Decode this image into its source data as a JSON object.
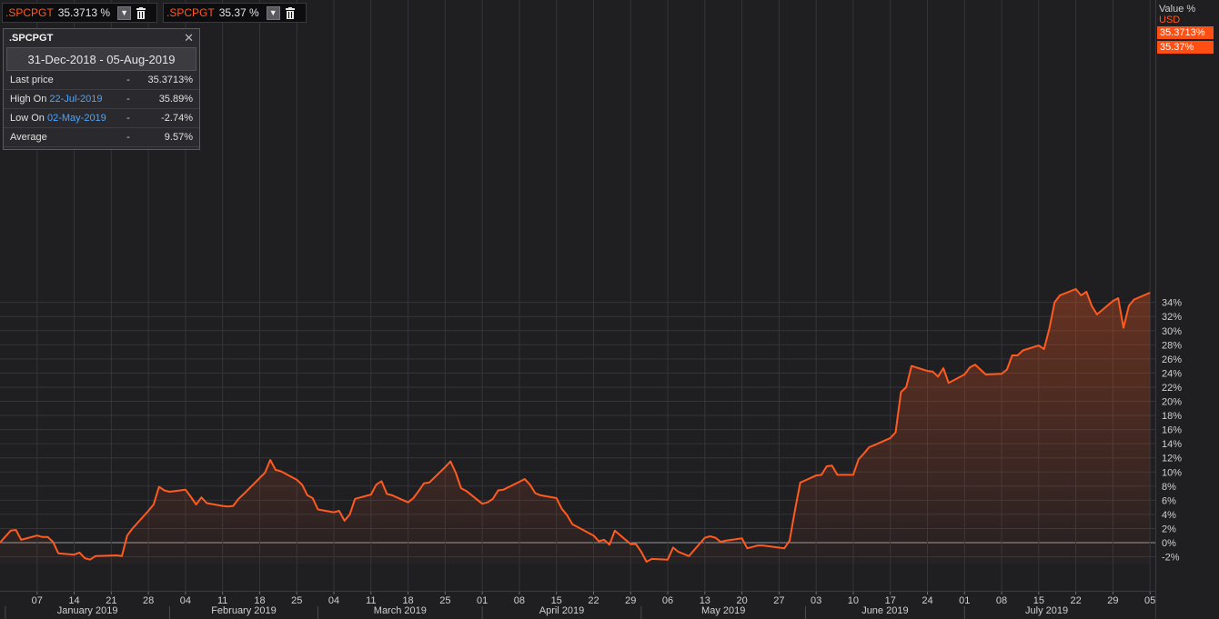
{
  "legend": [
    {
      "name": ".SPCPGT",
      "value": "35.3713 %"
    },
    {
      "name": ".SPCPGT",
      "value": "35.37 %"
    }
  ],
  "panel": {
    "title": ".SPCPGT",
    "range": "31-Dec-2018 - 05-Aug-2019",
    "rows": [
      {
        "label": "Last price",
        "date": "",
        "dash": "-",
        "value": "35.3713%"
      },
      {
        "label": "High On",
        "date": "22-Jul-2019",
        "dash": "-",
        "value": "35.89%"
      },
      {
        "label": "Low On",
        "date": "02-May-2019",
        "dash": "-",
        "value": "-2.74%"
      },
      {
        "label": "Average",
        "date": "",
        "dash": "-",
        "value": "9.57%"
      }
    ]
  },
  "axis": {
    "unit_label": "Value %",
    "currency": "USD",
    "value_tags": [
      "35.3713%",
      "35.37%"
    ]
  },
  "colors": {
    "line": "#ff5a1f",
    "background": "#1f1f22",
    "grid": "#34343a",
    "zero_line": "#9a9a9a"
  },
  "chart_data": {
    "type": "area",
    "ylim": [
      -3,
      38
    ],
    "yticks": [
      -2,
      0,
      2,
      4,
      6,
      8,
      10,
      12,
      14,
      16,
      18,
      20,
      22,
      24,
      26,
      28,
      30,
      32,
      34
    ],
    "ytick_labels": [
      "-2%",
      "0%",
      "2%",
      "4%",
      "6%",
      "8%",
      "10%",
      "12%",
      "14%",
      "16%",
      "18%",
      "20%",
      "22%",
      "24%",
      "26%",
      "28%",
      "30%",
      "32%",
      "34%"
    ],
    "x_start": "2018-12-31",
    "x_end": "2019-08-06",
    "xtick_dates": [
      "2019-01-07",
      "2019-01-14",
      "2019-01-21",
      "2019-01-28",
      "2019-02-04",
      "2019-02-11",
      "2019-02-18",
      "2019-02-25",
      "2019-03-04",
      "2019-03-11",
      "2019-03-18",
      "2019-03-25",
      "2019-04-01",
      "2019-04-08",
      "2019-04-15",
      "2019-04-22",
      "2019-04-29",
      "2019-05-06",
      "2019-05-13",
      "2019-05-20",
      "2019-05-27",
      "2019-06-03",
      "2019-06-10",
      "2019-06-17",
      "2019-06-24",
      "2019-07-01",
      "2019-07-08",
      "2019-07-15",
      "2019-07-22",
      "2019-07-29",
      "2019-08-05"
    ],
    "xtick_labels": [
      "07",
      "14",
      "21",
      "28",
      "04",
      "11",
      "18",
      "25",
      "04",
      "11",
      "18",
      "25",
      "01",
      "08",
      "15",
      "22",
      "29",
      "06",
      "13",
      "20",
      "27",
      "03",
      "10",
      "17",
      "24",
      "01",
      "08",
      "15",
      "22",
      "29",
      "05"
    ],
    "months": [
      {
        "label": "January 2019",
        "start": "2019-01-01",
        "end": "2019-01-31"
      },
      {
        "label": "February 2019",
        "start": "2019-02-01",
        "end": "2019-02-28"
      },
      {
        "label": "March 2019",
        "start": "2019-03-01",
        "end": "2019-03-31"
      },
      {
        "label": "April 2019",
        "start": "2019-04-01",
        "end": "2019-04-30"
      },
      {
        "label": "May 2019",
        "start": "2019-05-01",
        "end": "2019-05-31"
      },
      {
        "label": "June 2019",
        "start": "2019-06-01",
        "end": "2019-06-30"
      },
      {
        "label": "July 2019",
        "start": "2019-07-01",
        "end": "2019-07-31"
      }
    ],
    "series": [
      {
        "x": [
          "2018-12-31",
          "2019-01-02",
          "2019-01-03",
          "2019-01-04",
          "2019-01-07",
          "2019-01-08",
          "2019-01-09",
          "2019-01-10",
          "2019-01-11",
          "2019-01-14",
          "2019-01-15",
          "2019-01-16",
          "2019-01-17",
          "2019-01-18",
          "2019-01-22",
          "2019-01-23",
          "2019-01-24",
          "2019-01-25",
          "2019-01-28",
          "2019-01-29",
          "2019-01-30",
          "2019-01-31",
          "2019-02-01",
          "2019-02-04",
          "2019-02-05",
          "2019-02-06",
          "2019-02-07",
          "2019-02-08",
          "2019-02-11",
          "2019-02-12",
          "2019-02-13",
          "2019-02-14",
          "2019-02-15",
          "2019-02-19",
          "2019-02-20",
          "2019-02-21",
          "2019-02-22",
          "2019-02-25",
          "2019-02-26",
          "2019-02-27",
          "2019-02-28",
          "2019-03-01",
          "2019-03-04",
          "2019-03-05",
          "2019-03-06",
          "2019-03-07",
          "2019-03-08",
          "2019-03-11",
          "2019-03-12",
          "2019-03-13",
          "2019-03-14",
          "2019-03-15",
          "2019-03-18",
          "2019-03-19",
          "2019-03-20",
          "2019-03-21",
          "2019-03-22",
          "2019-03-25",
          "2019-03-26",
          "2019-03-27",
          "2019-03-28",
          "2019-03-29",
          "2019-04-01",
          "2019-04-02",
          "2019-04-03",
          "2019-04-04",
          "2019-04-05",
          "2019-04-08",
          "2019-04-09",
          "2019-04-10",
          "2019-04-11",
          "2019-04-12",
          "2019-04-15",
          "2019-04-16",
          "2019-04-17",
          "2019-04-18",
          "2019-04-22",
          "2019-04-23",
          "2019-04-24",
          "2019-04-25",
          "2019-04-26",
          "2019-04-29",
          "2019-04-30",
          "2019-05-01",
          "2019-05-02",
          "2019-05-03",
          "2019-05-06",
          "2019-05-07",
          "2019-05-08",
          "2019-05-09",
          "2019-05-10",
          "2019-05-13",
          "2019-05-14",
          "2019-05-15",
          "2019-05-16",
          "2019-05-17",
          "2019-05-20",
          "2019-05-21",
          "2019-05-22",
          "2019-05-23",
          "2019-05-24",
          "2019-05-28",
          "2019-05-29",
          "2019-05-30",
          "2019-05-31",
          "2019-06-03",
          "2019-06-04",
          "2019-06-05",
          "2019-06-06",
          "2019-06-07",
          "2019-06-10",
          "2019-06-11",
          "2019-06-12",
          "2019-06-13",
          "2019-06-14",
          "2019-06-17",
          "2019-06-18",
          "2019-06-19",
          "2019-06-20",
          "2019-06-21",
          "2019-06-24",
          "2019-06-25",
          "2019-06-26",
          "2019-06-27",
          "2019-06-28",
          "2019-07-01",
          "2019-07-02",
          "2019-07-03",
          "2019-07-05",
          "2019-07-08",
          "2019-07-09",
          "2019-07-10",
          "2019-07-11",
          "2019-07-12",
          "2019-07-15",
          "2019-07-16",
          "2019-07-17",
          "2019-07-18",
          "2019-07-19",
          "2019-07-22",
          "2019-07-23",
          "2019-07-24",
          "2019-07-25",
          "2019-07-26",
          "2019-07-29",
          "2019-07-30",
          "2019-07-31",
          "2019-08-01",
          "2019-08-02",
          "2019-08-05"
        ],
        "y": [
          0.0,
          1.7,
          1.8,
          0.4,
          1.0,
          0.8,
          0.8,
          0.1,
          -1.5,
          -1.7,
          -1.4,
          -2.2,
          -2.4,
          -1.9,
          -1.8,
          -1.9,
          1.0,
          2.0,
          4.5,
          5.4,
          7.9,
          7.4,
          7.2,
          7.5,
          6.5,
          5.4,
          6.4,
          5.6,
          5.2,
          5.1,
          5.2,
          6.2,
          6.9,
          9.9,
          11.7,
          10.3,
          10.1,
          8.9,
          8.2,
          6.7,
          6.3,
          4.7,
          4.3,
          4.5,
          3.1,
          4.0,
          6.2,
          6.8,
          8.2,
          8.7,
          6.9,
          6.7,
          5.7,
          6.3,
          7.3,
          8.4,
          8.5,
          10.7,
          11.5,
          9.9,
          7.7,
          7.3,
          5.5,
          5.7,
          6.2,
          7.4,
          7.5,
          8.6,
          9.0,
          8.2,
          7.0,
          6.7,
          6.3,
          4.8,
          3.9,
          2.6,
          1.0,
          0.2,
          0.4,
          -0.3,
          1.7,
          -0.2,
          -0.2,
          -1.3,
          -2.7,
          -2.3,
          -2.4,
          -0.7,
          -1.3,
          -1.6,
          -1.9,
          0.7,
          0.9,
          0.7,
          0.1,
          0.3,
          0.6,
          -0.8,
          -0.6,
          -0.4,
          -0.4,
          -0.8,
          0.3,
          4.6,
          8.5,
          9.5,
          9.6,
          10.8,
          10.9,
          9.6,
          9.6,
          11.8,
          12.6,
          13.5,
          13.8,
          14.8,
          15.6,
          21.3,
          22.0,
          25.0,
          24.3,
          24.2,
          23.5,
          24.7,
          22.6,
          23.8,
          24.8,
          25.2,
          23.8,
          23.9,
          24.5,
          26.5,
          26.5,
          27.2,
          27.9,
          27.4,
          30.3,
          34.0,
          35.0,
          35.89,
          35.0,
          35.5,
          33.5,
          32.3,
          34.2,
          34.6,
          30.4,
          33.5,
          34.4,
          35.3713
        ]
      }
    ]
  }
}
